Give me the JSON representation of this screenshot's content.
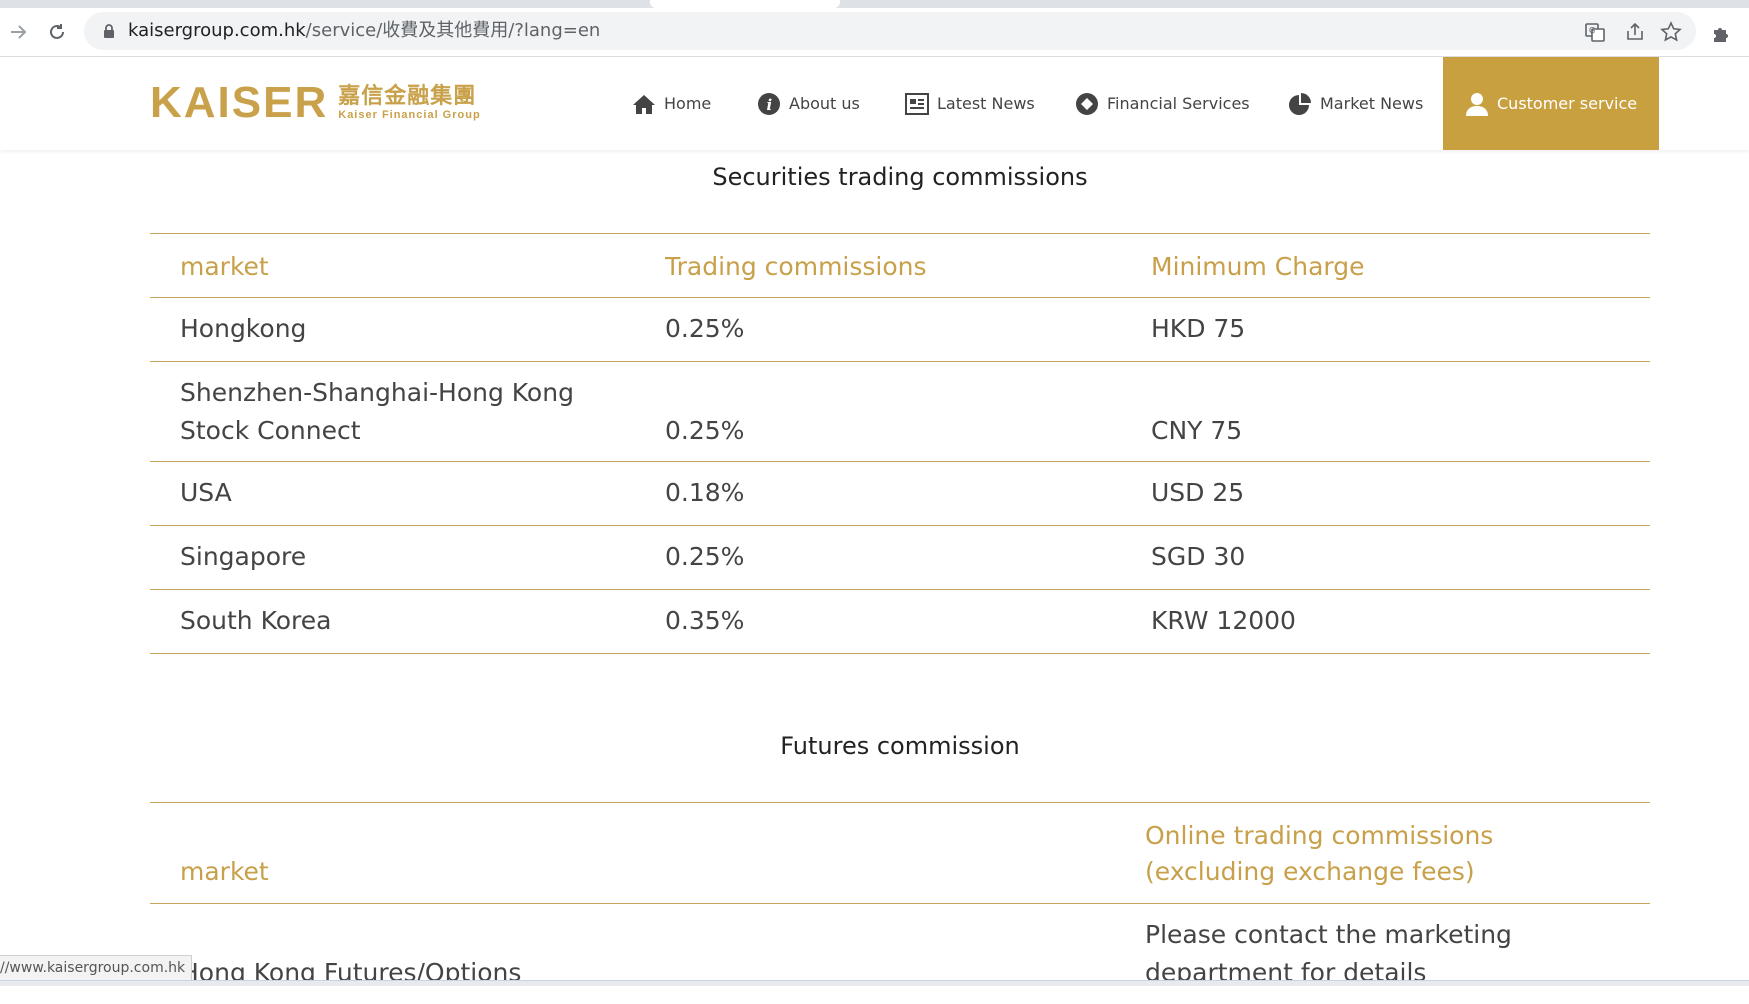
{
  "browser": {
    "url_host": "kaisergroup.com.hk",
    "url_path": "/service/收費及其他費用/?lang=en",
    "status_url": "//www.kaisergroup.com.hk"
  },
  "logo": {
    "latin": "KAISER",
    "chinese": "嘉信金融集團",
    "english": "Kaiser Financial Group"
  },
  "nav": {
    "home": "Home",
    "about": "About us",
    "latest_news": "Latest News",
    "financial_services": "Financial Services",
    "market_news": "Market News",
    "customer_service": "Customer service"
  },
  "colors": {
    "accent": "#c9a03f",
    "rule": "#c8a45c"
  },
  "securities": {
    "title": "Securities trading commissions",
    "headers": [
      "market",
      "Trading commissions",
      "Minimum Charge"
    ],
    "rows": [
      [
        "Hongkong",
        "0.25%",
        "HKD 75"
      ],
      [
        "Shenzhen-Shanghai-Hong Kong Stock Connect",
        "0.25%",
        "CNY 75"
      ],
      [
        "USA",
        "0.18%",
        "USD 25"
      ],
      [
        "Singapore",
        "0.25%",
        "SGD 30"
      ],
      [
        "South Korea",
        "0.35%",
        "KRW 12000"
      ]
    ],
    "row1_line1": "Shenzhen-Shanghai-Hong Kong",
    "row1_line2": "Stock Connect"
  },
  "futures": {
    "title": "Futures commission",
    "header_market": "market",
    "header_commission_line1": "Online trading commissions",
    "header_commission_line2": "(excluding exchange fees)",
    "row_market": "Hong Kong Futures/Options",
    "row_commission_line1": "Please contact the marketing",
    "row_commission_line2": "department for details"
  }
}
